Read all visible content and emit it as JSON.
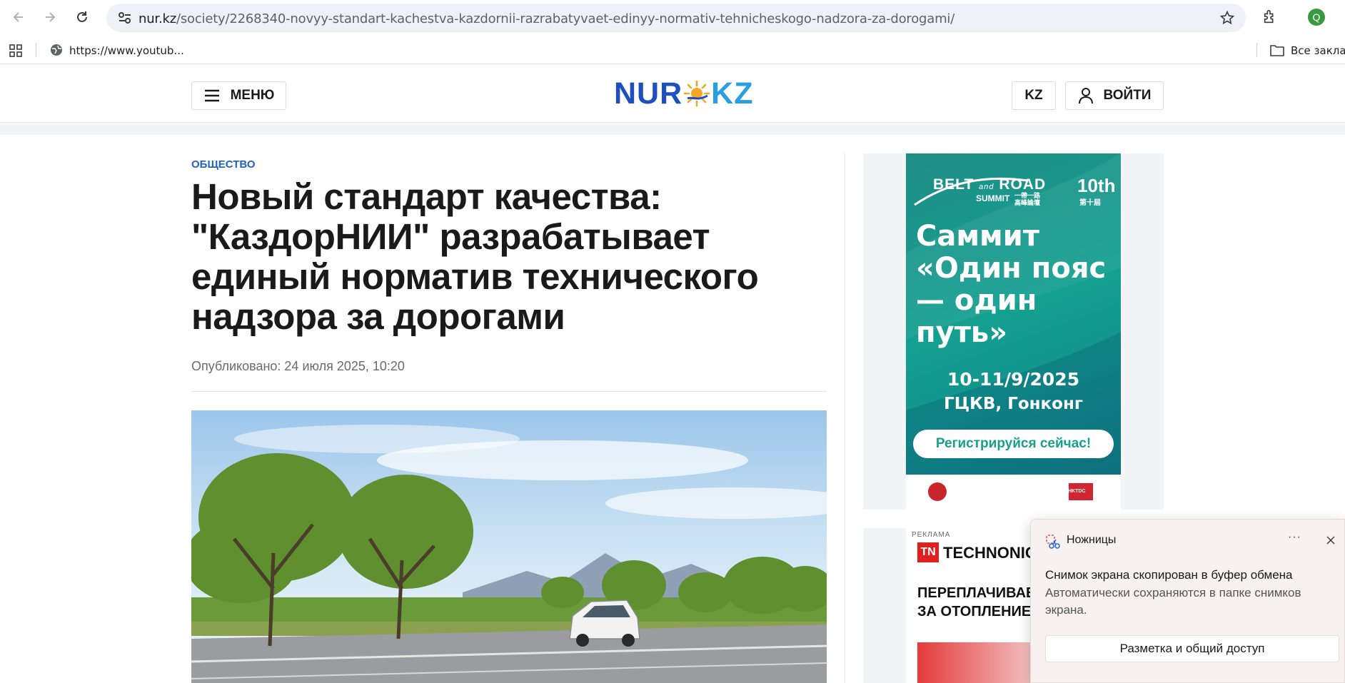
{
  "browser": {
    "url_host": "nur.kz",
    "url_path": "/society/2268340-novyy-standart-kachestva-kazdornii-razrabatyvaet-edinyy-normativ-tehnicheskogo-nadzora-za-dorogami/",
    "profile_initial": "Q",
    "bookmark_link": "https://www.youtub...",
    "all_bookmarks": "Все заклад"
  },
  "header": {
    "menu_label": "МЕНЮ",
    "logo_left": "NUR",
    "logo_right": "KZ",
    "lang_label": "KZ",
    "login_label": "ВОЙТИ"
  },
  "article": {
    "category": "ОБЩЕСТВО",
    "headline": "Новый стандарт качества: \"КаздорНИИ\" разрабатывает единый норматив технического надзора за дорогами",
    "published": "Опубликовано: 24 июля 2025, 10:20"
  },
  "ads": {
    "ad1": {
      "brand_top": "BELT",
      "brand_and": "and",
      "brand_road": "ROAD",
      "summit": "SUMMIT",
      "cjk": "一帶一路\n高峰論壇",
      "edition": "10th",
      "edition_cjk": "第十屆",
      "headline": "Саммит «Один пояс — один путь»",
      "dates": "10-11/9/2025",
      "venue": "ГЦКВ, Гонконг",
      "cta": "Регистрируйся сейчас!",
      "footer_logo": "HKTDC"
    },
    "ad2": {
      "label": "РЕКЛАМА",
      "brand": "TECHNONICO",
      "text": "ПЕРЕПЛАЧИВАЕ\nЗА ОТОПЛЕНИЕ"
    }
  },
  "toast": {
    "app_name": "Ножницы",
    "message_title": "Снимок экрана скопирован в буфер обмена",
    "message_body": "Автоматически сохраняются в папке снимков экрана.",
    "action": "Разметка и общий доступ",
    "more": "···"
  },
  "colors": {
    "accent_blue": "#2060c8",
    "logo_blue": "#1e4fbe",
    "logo_light": "#2a9fe0",
    "ad_teal": "#14a091"
  }
}
